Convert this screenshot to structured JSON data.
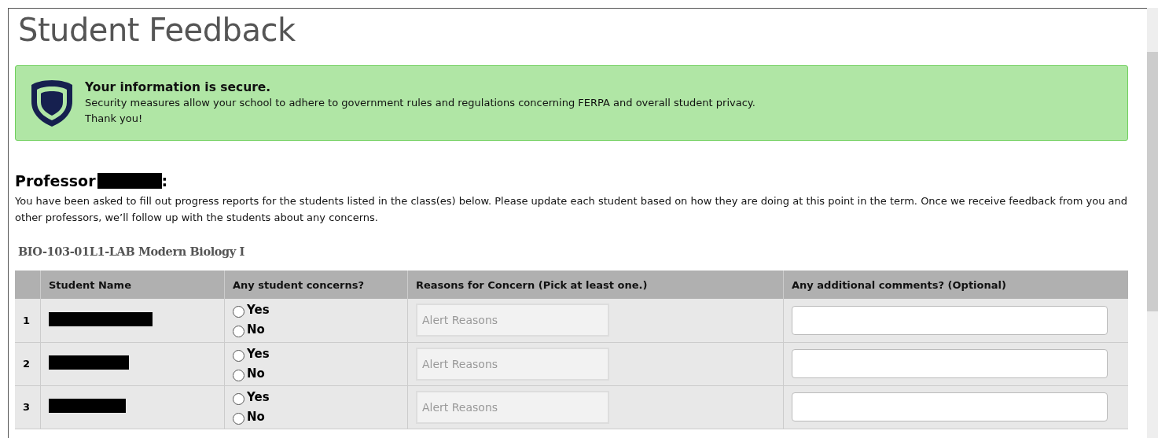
{
  "page_title": "Student Feedback",
  "notice": {
    "title": "Your information is secure.",
    "text": "Security measures allow your school to adhere to government rules and regulations concerning FERPA and overall student privacy.",
    "thanks": "Thank you!"
  },
  "greeting": {
    "prefix": "Professor",
    "suffix": ":",
    "name_redacted": true
  },
  "intro": "You have been asked to fill out progress reports for the students listed in the class(es) below. Please update each student based on how they are doing at this point in the term. Once we receive feedback from you and other professors, we’ll follow up with the students about any concerns.",
  "course": {
    "title": "BIO-103-01L1-LAB Modern Biology I",
    "columns": [
      "Student Name",
      "Any student concerns?",
      "Reasons for Concern (Pick at least one.)",
      "Any additional comments? (Optional)"
    ],
    "rows": [
      {
        "number": "1",
        "name_redacted": true,
        "options": [
          {
            "label": "Yes",
            "selected": false
          },
          {
            "label": "No",
            "selected": false
          }
        ],
        "reasons_placeholder": "Alert Reasons"
      },
      {
        "number": "2",
        "name_redacted": true,
        "options": [
          {
            "label": "Yes",
            "selected": false
          },
          {
            "label": "No",
            "selected": false
          }
        ],
        "reasons_placeholder": "Alert Reasons"
      },
      {
        "number": "3",
        "name_redacted": true,
        "options": [
          {
            "label": "Yes",
            "selected": false
          },
          {
            "label": "No",
            "selected": false
          }
        ],
        "reasons_placeholder": "Alert Reasons"
      }
    ]
  }
}
